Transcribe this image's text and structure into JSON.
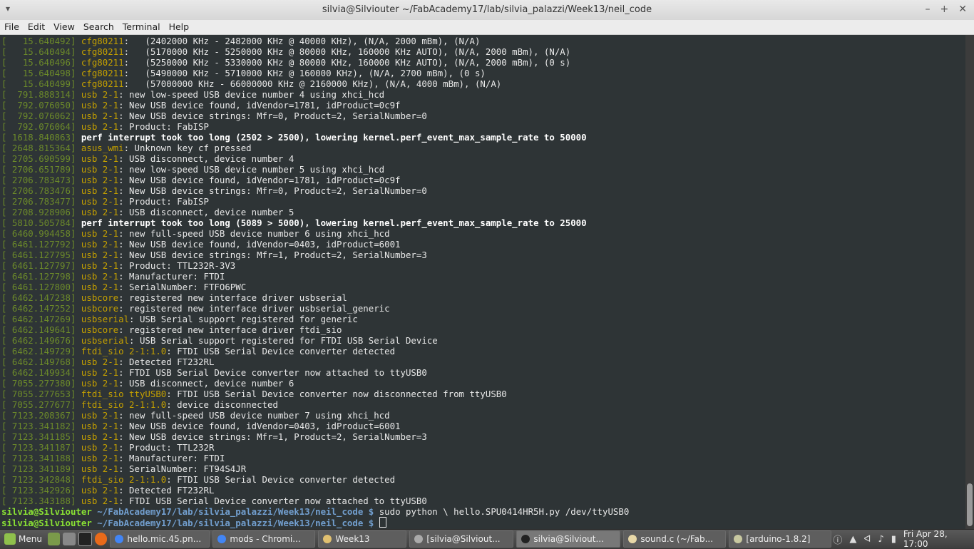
{
  "window": {
    "title": "silvia@Silviouter ~/FabAcademy17/lab/silvia_palazzi/Week13/neil_code"
  },
  "menu": [
    "File",
    "Edit",
    "View",
    "Search",
    "Terminal",
    "Help"
  ],
  "terminal": {
    "lines": [
      {
        "ts": "[   15.640492]",
        "src": "cfg80211",
        "text": ":   (2402000 KHz - 2482000 KHz @ 40000 KHz), (N/A, 2000 mBm), (N/A)"
      },
      {
        "ts": "[   15.640494]",
        "src": "cfg80211",
        "text": ":   (5170000 KHz - 5250000 KHz @ 80000 KHz, 160000 KHz AUTO), (N/A, 2000 mBm), (N/A)"
      },
      {
        "ts": "[   15.640496]",
        "src": "cfg80211",
        "text": ":   (5250000 KHz - 5330000 KHz @ 80000 KHz, 160000 KHz AUTO), (N/A, 2000 mBm), (0 s)"
      },
      {
        "ts": "[   15.640498]",
        "src": "cfg80211",
        "text": ":   (5490000 KHz - 5710000 KHz @ 160000 KHz), (N/A, 2700 mBm), (0 s)"
      },
      {
        "ts": "[   15.640499]",
        "src": "cfg80211",
        "text": ":   (57000000 KHz - 66000000 KHz @ 2160000 KHz), (N/A, 4000 mBm), (N/A)"
      },
      {
        "ts": "[  791.888314]",
        "src": "usb 2-1",
        "text": ": new low-speed USB device number 4 using xhci_hcd"
      },
      {
        "ts": "[  792.076050]",
        "src": "usb 2-1",
        "text": ": New USB device found, idVendor=1781, idProduct=0c9f"
      },
      {
        "ts": "[  792.076062]",
        "src": "usb 2-1",
        "text": ": New USB device strings: Mfr=0, Product=2, SerialNumber=0"
      },
      {
        "ts": "[  792.076064]",
        "src": "usb 2-1",
        "text": ": Product: FabISP"
      },
      {
        "ts": "[ 1618.840863]",
        "src": "",
        "text": "perf interrupt took too long (2502 > 2500), lowering kernel.perf_event_max_sample_rate to 50000",
        "bold": true
      },
      {
        "ts": "[ 2648.815364]",
        "src": "asus_wmi",
        "text": ": Unknown key cf pressed"
      },
      {
        "ts": "[ 2705.690599]",
        "src": "usb 2-1",
        "text": ": USB disconnect, device number 4"
      },
      {
        "ts": "[ 2706.651789]",
        "src": "usb 2-1",
        "text": ": new low-speed USB device number 5 using xhci_hcd"
      },
      {
        "ts": "[ 2706.783473]",
        "src": "usb 2-1",
        "text": ": New USB device found, idVendor=1781, idProduct=0c9f"
      },
      {
        "ts": "[ 2706.783476]",
        "src": "usb 2-1",
        "text": ": New USB device strings: Mfr=0, Product=2, SerialNumber=0"
      },
      {
        "ts": "[ 2706.783477]",
        "src": "usb 2-1",
        "text": ": Product: FabISP"
      },
      {
        "ts": "[ 2708.928906]",
        "src": "usb 2-1",
        "text": ": USB disconnect, device number 5"
      },
      {
        "ts": "[ 5810.505784]",
        "src": "",
        "text": "perf interrupt took too long (5089 > 5000), lowering kernel.perf_event_max_sample_rate to 25000",
        "bold": true
      },
      {
        "ts": "[ 6460.994458]",
        "src": "usb 2-1",
        "text": ": new full-speed USB device number 6 using xhci_hcd"
      },
      {
        "ts": "[ 6461.127792]",
        "src": "usb 2-1",
        "text": ": New USB device found, idVendor=0403, idProduct=6001"
      },
      {
        "ts": "[ 6461.127795]",
        "src": "usb 2-1",
        "text": ": New USB device strings: Mfr=1, Product=2, SerialNumber=3"
      },
      {
        "ts": "[ 6461.127797]",
        "src": "usb 2-1",
        "text": ": Product: TTL232R-3V3"
      },
      {
        "ts": "[ 6461.127798]",
        "src": "usb 2-1",
        "text": ": Manufacturer: FTDI"
      },
      {
        "ts": "[ 6461.127800]",
        "src": "usb 2-1",
        "text": ": SerialNumber: FTFO6PWC"
      },
      {
        "ts": "[ 6462.147238]",
        "src": "usbcore",
        "text": ": registered new interface driver usbserial"
      },
      {
        "ts": "[ 6462.147252]",
        "src": "usbcore",
        "text": ": registered new interface driver usbserial_generic"
      },
      {
        "ts": "[ 6462.147269]",
        "src": "usbserial",
        "text": ": USB Serial support registered for generic"
      },
      {
        "ts": "[ 6462.149641]",
        "src": "usbcore",
        "text": ": registered new interface driver ftdi_sio"
      },
      {
        "ts": "[ 6462.149676]",
        "src": "usbserial",
        "text": ": USB Serial support registered for FTDI USB Serial Device"
      },
      {
        "ts": "[ 6462.149729]",
        "src": "ftdi_sio 2-1:1.0",
        "text": ": FTDI USB Serial Device converter detected"
      },
      {
        "ts": "[ 6462.149768]",
        "src": "usb 2-1",
        "text": ": Detected FT232RL"
      },
      {
        "ts": "[ 6462.149934]",
        "src": "usb 2-1",
        "text": ": FTDI USB Serial Device converter now attached to ttyUSB0"
      },
      {
        "ts": "[ 7055.277380]",
        "src": "usb 2-1",
        "text": ": USB disconnect, device number 6"
      },
      {
        "ts": "[ 7055.277653]",
        "src": "ftdi_sio ttyUSB0",
        "text": ": FTDI USB Serial Device converter now disconnected from ttyUSB0"
      },
      {
        "ts": "[ 7055.277677]",
        "src": "ftdi_sio 2-1:1.0",
        "text": ": device disconnected"
      },
      {
        "ts": "[ 7123.208367]",
        "src": "usb 2-1",
        "text": ": new full-speed USB device number 7 using xhci_hcd"
      },
      {
        "ts": "[ 7123.341182]",
        "src": "usb 2-1",
        "text": ": New USB device found, idVendor=0403, idProduct=6001"
      },
      {
        "ts": "[ 7123.341185]",
        "src": "usb 2-1",
        "text": ": New USB device strings: Mfr=1, Product=2, SerialNumber=3"
      },
      {
        "ts": "[ 7123.341187]",
        "src": "usb 2-1",
        "text": ": Product: TTL232R"
      },
      {
        "ts": "[ 7123.341188]",
        "src": "usb 2-1",
        "text": ": Manufacturer: FTDI"
      },
      {
        "ts": "[ 7123.341189]",
        "src": "usb 2-1",
        "text": ": SerialNumber: FT94S4JR"
      },
      {
        "ts": "[ 7123.342848]",
        "src": "ftdi_sio 2-1:1.0",
        "text": ": FTDI USB Serial Device converter detected"
      },
      {
        "ts": "[ 7123.342926]",
        "src": "usb 2-1",
        "text": ": Detected FT232RL"
      },
      {
        "ts": "[ 7123.343188]",
        "src": "usb 2-1",
        "text": ": FTDI USB Serial Device converter now attached to ttyUSB0"
      }
    ],
    "prompts": [
      {
        "user": "silvia@Silviouter",
        "path": "~/FabAcademy17/lab/silvia_palazzi/Week13/neil_code",
        "sym": "$",
        "cmd": " sudo python \\ hello.SPU0414HR5H.py /dev/ttyUSB0"
      },
      {
        "user": "silvia@Silviouter",
        "path": "~/FabAcademy17/lab/silvia_palazzi/Week13/neil_code",
        "sym": "$",
        "cmd": " "
      }
    ]
  },
  "taskbar": {
    "menu_label": "Menu",
    "tasks": [
      {
        "label": "hello.mic.45.pn...",
        "color": "#4285f4",
        "active": false
      },
      {
        "label": "mods - Chromi...",
        "color": "#4285f4",
        "active": false
      },
      {
        "label": "Week13",
        "color": "#e0c070",
        "active": false
      },
      {
        "label": "[silvia@Silviout...",
        "color": "#aaaaaa",
        "active": false
      },
      {
        "label": "silvia@Silviout...",
        "color": "#222222",
        "active": true
      },
      {
        "label": "sound.c (~/Fab...",
        "color": "#e8d8a8",
        "active": false
      },
      {
        "label": "[arduino-1.8.2]",
        "color": "#c8c8a0",
        "active": false
      }
    ],
    "clock": "Fri Apr 28, 17:00"
  }
}
